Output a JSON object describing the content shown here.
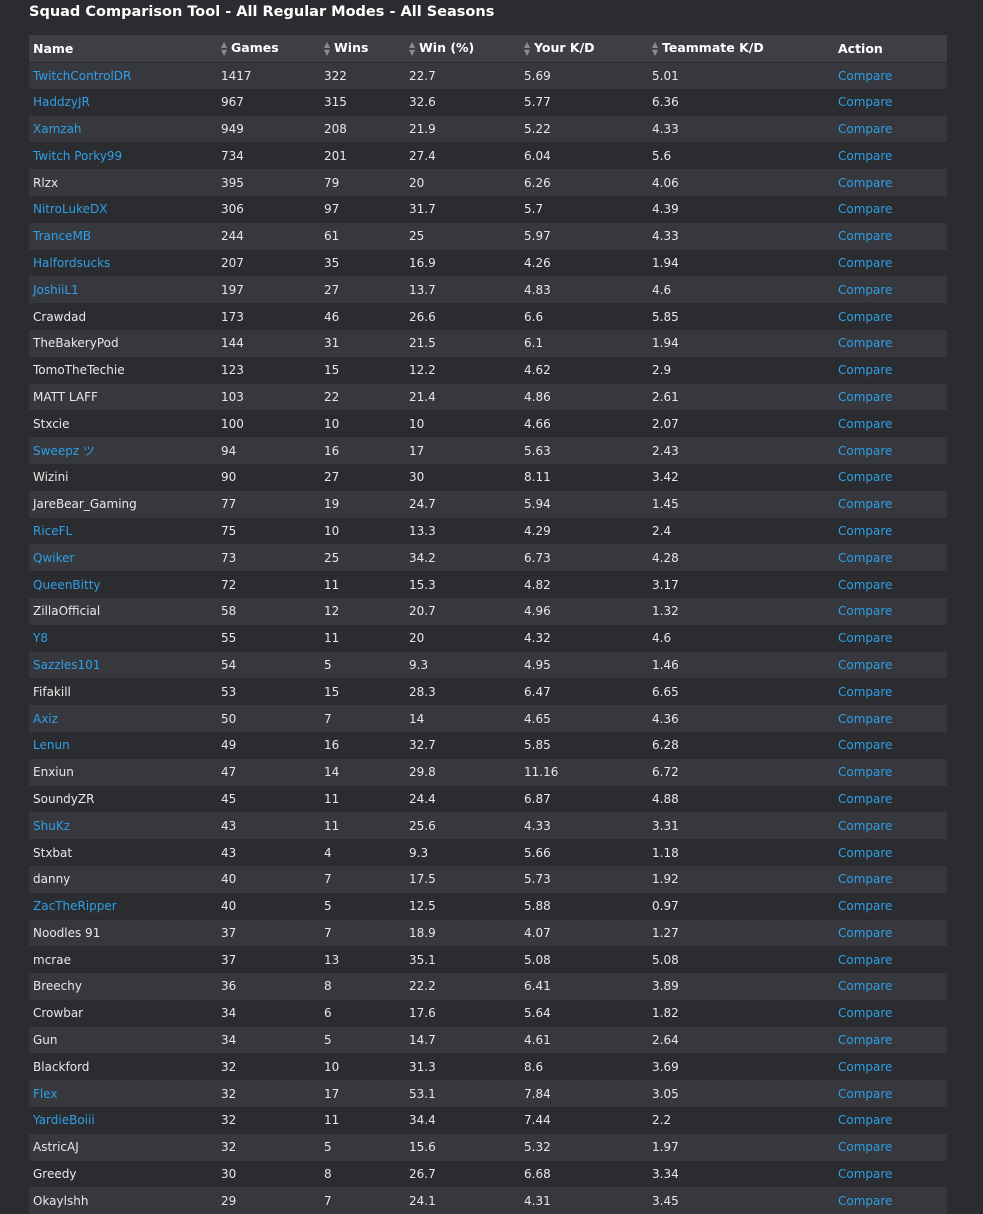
{
  "title": "Squad Comparison Tool - All Regular Modes - All Seasons",
  "columns": [
    "Name",
    "Games",
    "Wins",
    "Win (%)",
    "Your K/D",
    "Teammate K/D",
    "Action"
  ],
  "sort_icon": "sort-icon",
  "colors": {
    "link": "#2f9fe6",
    "background": "#2b2c30",
    "header": "#3d3f45",
    "row_alt": "#36383d"
  },
  "rows": [
    {
      "name": "TwitchControlDR",
      "linked": true,
      "games": "1417",
      "wins": "322",
      "win_pct": "22.7",
      "your_kd": "5.69",
      "teammate_kd": "5.01",
      "action": "Compare"
    },
    {
      "name": "HaddzyJR",
      "linked": true,
      "games": "967",
      "wins": "315",
      "win_pct": "32.6",
      "your_kd": "5.77",
      "teammate_kd": "6.36",
      "action": "Compare"
    },
    {
      "name": "Xamzah",
      "linked": true,
      "games": "949",
      "wins": "208",
      "win_pct": "21.9",
      "your_kd": "5.22",
      "teammate_kd": "4.33",
      "action": "Compare"
    },
    {
      "name": "Twitch Porky99",
      "linked": true,
      "games": "734",
      "wins": "201",
      "win_pct": "27.4",
      "your_kd": "6.04",
      "teammate_kd": "5.6",
      "action": "Compare"
    },
    {
      "name": "Rlzx",
      "linked": false,
      "games": "395",
      "wins": "79",
      "win_pct": "20",
      "your_kd": "6.26",
      "teammate_kd": "4.06",
      "action": "Compare"
    },
    {
      "name": "NitroLukeDX",
      "linked": true,
      "games": "306",
      "wins": "97",
      "win_pct": "31.7",
      "your_kd": "5.7",
      "teammate_kd": "4.39",
      "action": "Compare"
    },
    {
      "name": "TranceMB",
      "linked": true,
      "games": "244",
      "wins": "61",
      "win_pct": "25",
      "your_kd": "5.97",
      "teammate_kd": "4.33",
      "action": "Compare"
    },
    {
      "name": "Halfordsucks",
      "linked": true,
      "games": "207",
      "wins": "35",
      "win_pct": "16.9",
      "your_kd": "4.26",
      "teammate_kd": "1.94",
      "action": "Compare"
    },
    {
      "name": "JoshiiL1",
      "linked": true,
      "games": "197",
      "wins": "27",
      "win_pct": "13.7",
      "your_kd": "4.83",
      "teammate_kd": "4.6",
      "action": "Compare"
    },
    {
      "name": "Crawdad",
      "linked": false,
      "games": "173",
      "wins": "46",
      "win_pct": "26.6",
      "your_kd": "6.6",
      "teammate_kd": "5.85",
      "action": "Compare"
    },
    {
      "name": "TheBakeryPod",
      "linked": false,
      "games": "144",
      "wins": "31",
      "win_pct": "21.5",
      "your_kd": "6.1",
      "teammate_kd": "1.94",
      "action": "Compare"
    },
    {
      "name": "TomoTheTechie",
      "linked": false,
      "games": "123",
      "wins": "15",
      "win_pct": "12.2",
      "your_kd": "4.62",
      "teammate_kd": "2.9",
      "action": "Compare"
    },
    {
      "name": "MATT LAFF",
      "linked": false,
      "games": "103",
      "wins": "22",
      "win_pct": "21.4",
      "your_kd": "4.86",
      "teammate_kd": "2.61",
      "action": "Compare"
    },
    {
      "name": "Stxcie",
      "linked": false,
      "games": "100",
      "wins": "10",
      "win_pct": "10",
      "your_kd": "4.66",
      "teammate_kd": "2.07",
      "action": "Compare"
    },
    {
      "name": "Sweepz ツ",
      "linked": true,
      "games": "94",
      "wins": "16",
      "win_pct": "17",
      "your_kd": "5.63",
      "teammate_kd": "2.43",
      "action": "Compare"
    },
    {
      "name": "Wizini",
      "linked": false,
      "games": "90",
      "wins": "27",
      "win_pct": "30",
      "your_kd": "8.11",
      "teammate_kd": "3.42",
      "action": "Compare"
    },
    {
      "name": "JareBear_Gaming",
      "linked": false,
      "games": "77",
      "wins": "19",
      "win_pct": "24.7",
      "your_kd": "5.94",
      "teammate_kd": "1.45",
      "action": "Compare"
    },
    {
      "name": "RiceFL",
      "linked": true,
      "games": "75",
      "wins": "10",
      "win_pct": "13.3",
      "your_kd": "4.29",
      "teammate_kd": "2.4",
      "action": "Compare"
    },
    {
      "name": "Qwiker",
      "linked": true,
      "games": "73",
      "wins": "25",
      "win_pct": "34.2",
      "your_kd": "6.73",
      "teammate_kd": "4.28",
      "action": "Compare"
    },
    {
      "name": "QueenBitty",
      "linked": true,
      "games": "72",
      "wins": "11",
      "win_pct": "15.3",
      "your_kd": "4.82",
      "teammate_kd": "3.17",
      "action": "Compare"
    },
    {
      "name": "ZillaOfficial",
      "linked": false,
      "games": "58",
      "wins": "12",
      "win_pct": "20.7",
      "your_kd": "4.96",
      "teammate_kd": "1.32",
      "action": "Compare"
    },
    {
      "name": "Y8",
      "linked": true,
      "games": "55",
      "wins": "11",
      "win_pct": "20",
      "your_kd": "4.32",
      "teammate_kd": "4.6",
      "action": "Compare"
    },
    {
      "name": "Sazzles101",
      "linked": true,
      "games": "54",
      "wins": "5",
      "win_pct": "9.3",
      "your_kd": "4.95",
      "teammate_kd": "1.46",
      "action": "Compare"
    },
    {
      "name": "Fifakill",
      "linked": false,
      "games": "53",
      "wins": "15",
      "win_pct": "28.3",
      "your_kd": "6.47",
      "teammate_kd": "6.65",
      "action": "Compare"
    },
    {
      "name": "Axiz",
      "linked": true,
      "games": "50",
      "wins": "7",
      "win_pct": "14",
      "your_kd": "4.65",
      "teammate_kd": "4.36",
      "action": "Compare"
    },
    {
      "name": "Lenun",
      "linked": true,
      "games": "49",
      "wins": "16",
      "win_pct": "32.7",
      "your_kd": "5.85",
      "teammate_kd": "6.28",
      "action": "Compare"
    },
    {
      "name": "Enxiun",
      "linked": false,
      "games": "47",
      "wins": "14",
      "win_pct": "29.8",
      "your_kd": "11.16",
      "teammate_kd": "6.72",
      "action": "Compare"
    },
    {
      "name": "SoundyZR",
      "linked": false,
      "games": "45",
      "wins": "11",
      "win_pct": "24.4",
      "your_kd": "6.87",
      "teammate_kd": "4.88",
      "action": "Compare"
    },
    {
      "name": "ShuKz",
      "linked": true,
      "games": "43",
      "wins": "11",
      "win_pct": "25.6",
      "your_kd": "4.33",
      "teammate_kd": "3.31",
      "action": "Compare"
    },
    {
      "name": "Stxbat",
      "linked": false,
      "games": "43",
      "wins": "4",
      "win_pct": "9.3",
      "your_kd": "5.66",
      "teammate_kd": "1.18",
      "action": "Compare"
    },
    {
      "name": "danny",
      "linked": false,
      "games": "40",
      "wins": "7",
      "win_pct": "17.5",
      "your_kd": "5.73",
      "teammate_kd": "1.92",
      "action": "Compare"
    },
    {
      "name": "ZacTheRipper",
      "linked": true,
      "games": "40",
      "wins": "5",
      "win_pct": "12.5",
      "your_kd": "5.88",
      "teammate_kd": "0.97",
      "action": "Compare"
    },
    {
      "name": "Noodles 91",
      "linked": false,
      "games": "37",
      "wins": "7",
      "win_pct": "18.9",
      "your_kd": "4.07",
      "teammate_kd": "1.27",
      "action": "Compare"
    },
    {
      "name": "mcrae",
      "linked": false,
      "games": "37",
      "wins": "13",
      "win_pct": "35.1",
      "your_kd": "5.08",
      "teammate_kd": "5.08",
      "action": "Compare"
    },
    {
      "name": "Breechy",
      "linked": false,
      "games": "36",
      "wins": "8",
      "win_pct": "22.2",
      "your_kd": "6.41",
      "teammate_kd": "3.89",
      "action": "Compare"
    },
    {
      "name": "Crowbar",
      "linked": false,
      "games": "34",
      "wins": "6",
      "win_pct": "17.6",
      "your_kd": "5.64",
      "teammate_kd": "1.82",
      "action": "Compare"
    },
    {
      "name": "Gun",
      "linked": false,
      "games": "34",
      "wins": "5",
      "win_pct": "14.7",
      "your_kd": "4.61",
      "teammate_kd": "2.64",
      "action": "Compare"
    },
    {
      "name": "Blackford",
      "linked": false,
      "games": "32",
      "wins": "10",
      "win_pct": "31.3",
      "your_kd": "8.6",
      "teammate_kd": "3.69",
      "action": "Compare"
    },
    {
      "name": "Flex",
      "linked": true,
      "games": "32",
      "wins": "17",
      "win_pct": "53.1",
      "your_kd": "7.84",
      "teammate_kd": "3.05",
      "action": "Compare"
    },
    {
      "name": "YardieBoiii",
      "linked": true,
      "games": "32",
      "wins": "11",
      "win_pct": "34.4",
      "your_kd": "7.44",
      "teammate_kd": "2.2",
      "action": "Compare"
    },
    {
      "name": "AstricAJ",
      "linked": false,
      "games": "32",
      "wins": "5",
      "win_pct": "15.6",
      "your_kd": "5.32",
      "teammate_kd": "1.97",
      "action": "Compare"
    },
    {
      "name": "Greedy",
      "linked": false,
      "games": "30",
      "wins": "8",
      "win_pct": "26.7",
      "your_kd": "6.68",
      "teammate_kd": "3.34",
      "action": "Compare"
    },
    {
      "name": "Okaylshh",
      "linked": false,
      "games": "29",
      "wins": "7",
      "win_pct": "24.1",
      "your_kd": "4.31",
      "teammate_kd": "3.45",
      "action": "Compare"
    }
  ]
}
